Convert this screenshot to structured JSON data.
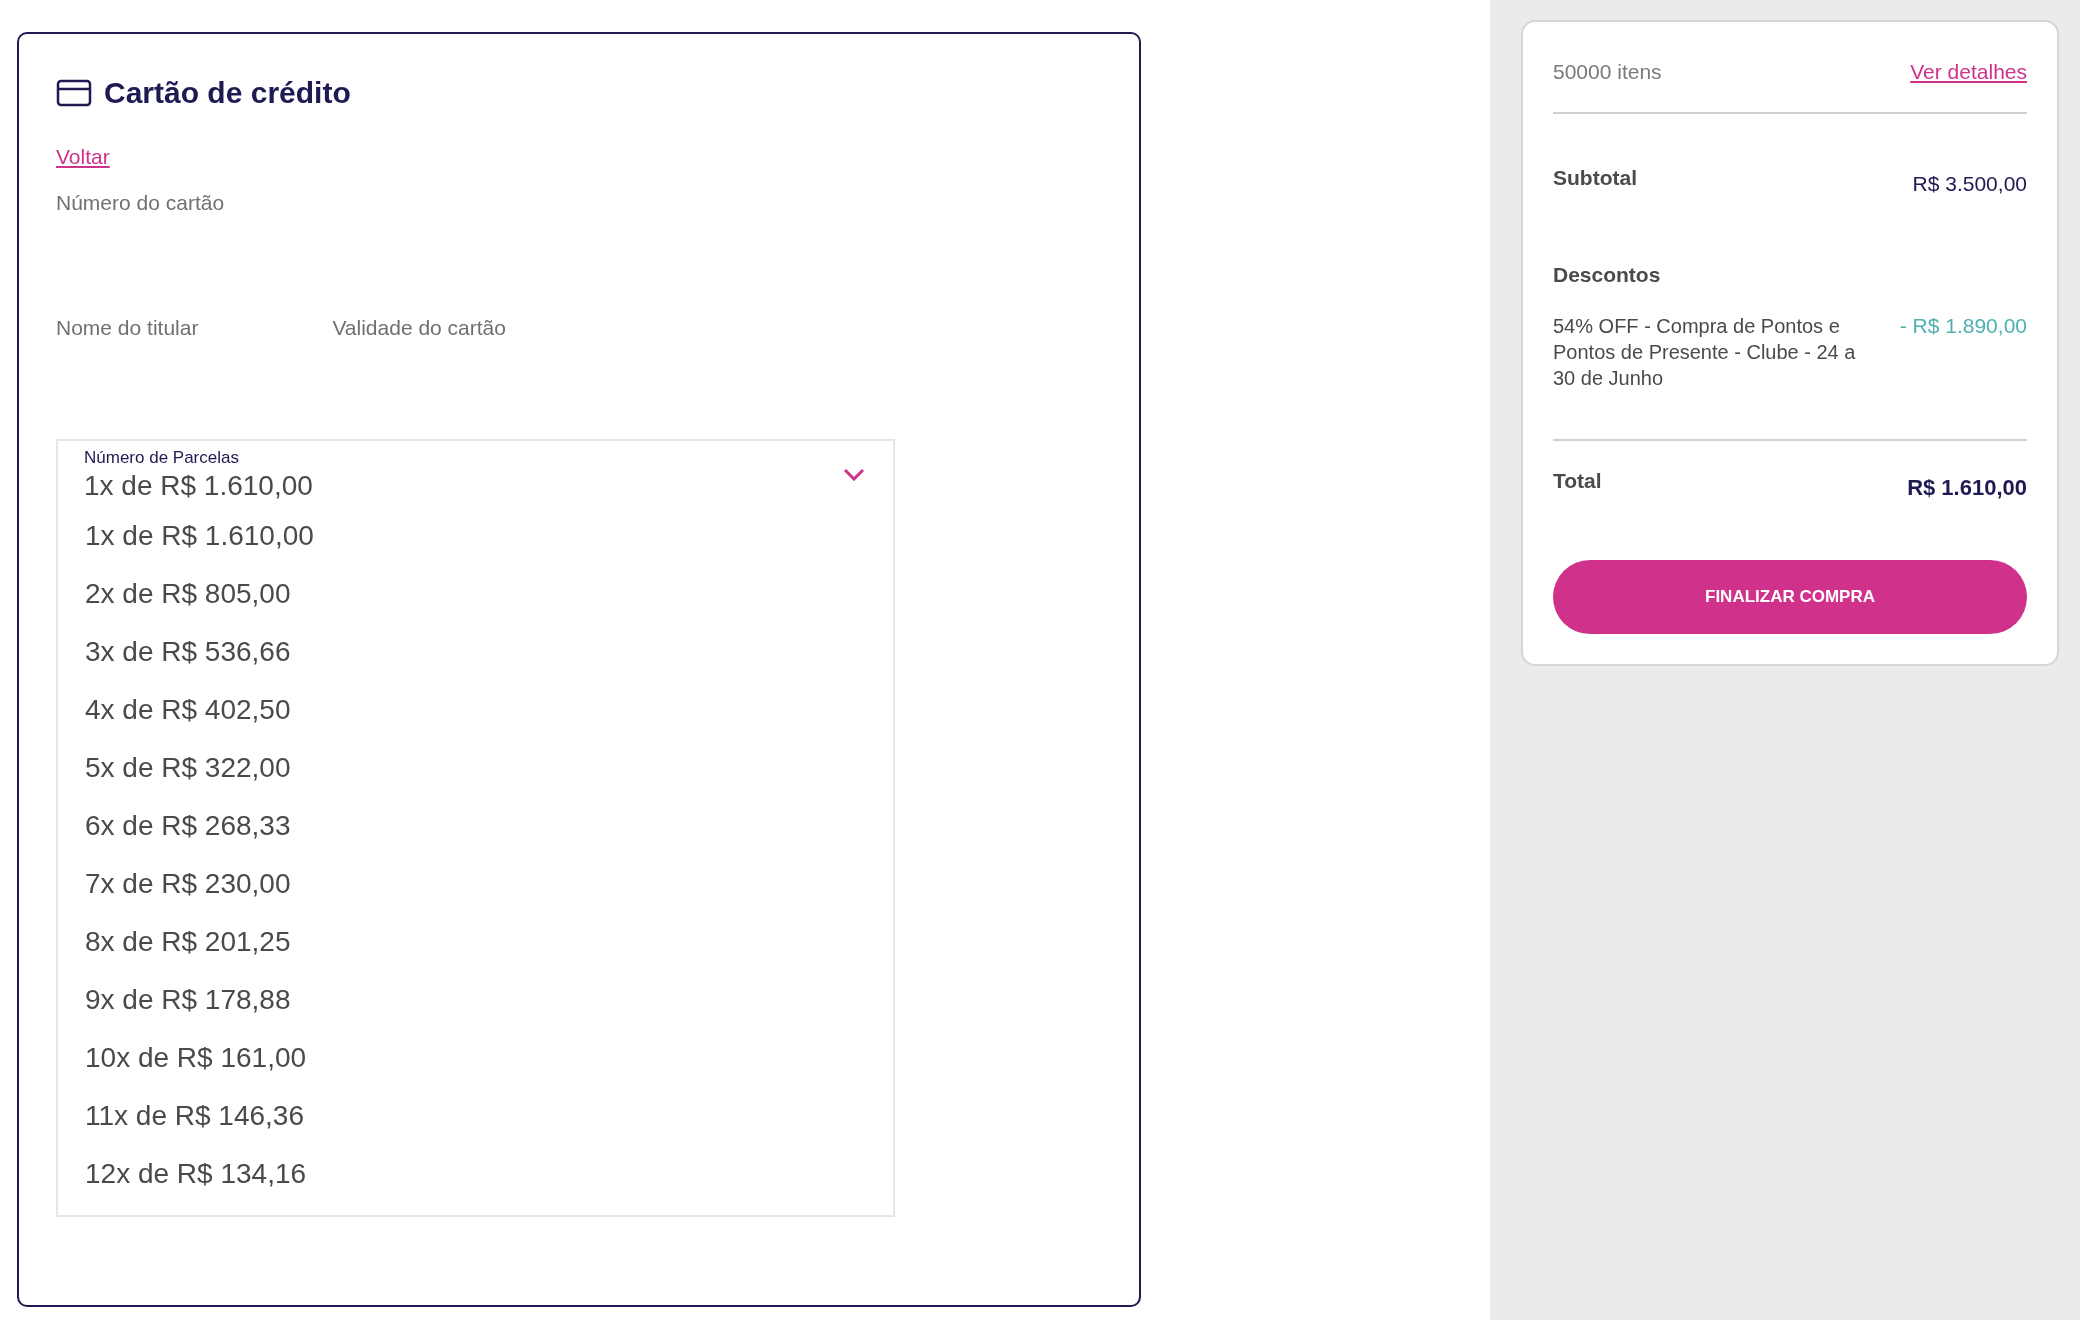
{
  "payment_card": {
    "title": "Cartão de crédito",
    "back_link": "Voltar",
    "card_number_label": "Número do cartão",
    "holder_name_label": "Nome do titular",
    "expiry_label": "Validade do cartão",
    "installments": {
      "label": "Número de Parcelas",
      "value": "1x de R$ 1.610,00",
      "options": [
        {
          "label": "1x de R$ 1.610,00"
        },
        {
          "label": "2x de R$ 805,00"
        },
        {
          "label": "3x de R$ 536,66"
        },
        {
          "label": "4x de R$ 402,50"
        },
        {
          "label": "5x de R$ 322,00"
        },
        {
          "label": "6x de R$ 268,33"
        },
        {
          "label": "7x de R$ 230,00"
        },
        {
          "label": "8x de R$ 201,25"
        },
        {
          "label": "9x de R$ 178,88"
        },
        {
          "label": "10x de R$ 161,00"
        },
        {
          "label": "11x de R$ 146,36"
        },
        {
          "label": "12x de R$ 134,16"
        }
      ]
    }
  },
  "summary": {
    "items_count": "50000 itens",
    "details_link": "Ver detalhes",
    "subtotal_label": "Subtotal",
    "subtotal_value": "R$ 3.500,00",
    "discounts_label": "Descontos",
    "discounts": [
      {
        "description": "54% OFF - Compra de Pontos e Pontos de Presente - Clube - 24 a 30 de Junho",
        "amount": "- R$ 1.890,00"
      }
    ],
    "total_label": "Total",
    "total_value": "R$ 1.610,00",
    "button": "FINALIZAR COMPRA"
  }
}
